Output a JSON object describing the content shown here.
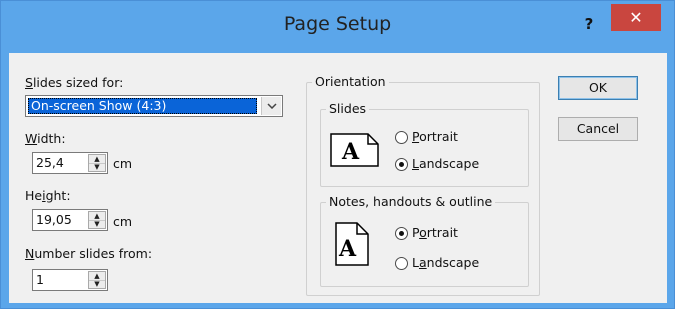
{
  "window": {
    "title": "Page Setup",
    "help_label": "?",
    "close_label": "✕"
  },
  "slides_sized_for": {
    "label_accel": "S",
    "label_rest": "lides sized for:",
    "selected": "On-screen Show (4:3)",
    "arrow": "⌄"
  },
  "width": {
    "label_accel": "W",
    "label_rest": "idth:",
    "value": "25,4",
    "unit": "cm"
  },
  "height": {
    "label_pre": "He",
    "label_accel": "i",
    "label_rest": "ght:",
    "value": "19,05",
    "unit": "cm"
  },
  "number_from": {
    "label_accel": "N",
    "label_rest": "umber slides from:",
    "value": "1"
  },
  "orientation": {
    "label": "Orientation",
    "slides": {
      "label": "Slides",
      "icon_letter": "A",
      "portrait": {
        "accel": "P",
        "rest": "ortrait",
        "checked": false
      },
      "landscape": {
        "accel": "L",
        "rest": "andscape",
        "checked": true
      }
    },
    "notes": {
      "label": "Notes, handouts & outline",
      "icon_letter": "A",
      "portrait": {
        "pre": "P",
        "accel": "o",
        "rest": "rtrait",
        "checked": true
      },
      "landscape": {
        "pre": "L",
        "accel": "a",
        "rest": "ndscape",
        "checked": false
      }
    }
  },
  "buttons": {
    "ok": "OK",
    "cancel": "Cancel"
  },
  "spin_glyphs": {
    "up": "▲",
    "down": "▼"
  }
}
